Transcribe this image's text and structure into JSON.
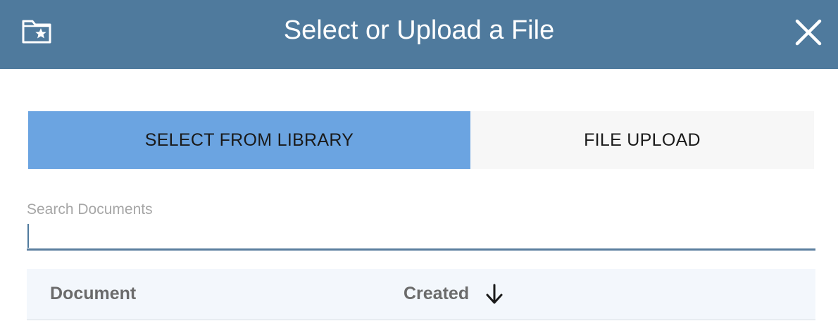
{
  "dialog": {
    "title": "Select or Upload a File",
    "header_icon": "folder-star-icon",
    "close_icon": "close-icon",
    "header_color": "#4f7a9d"
  },
  "tabs": [
    {
      "label": "SELECT FROM LIBRARY",
      "active": true,
      "color": "#6ba4e1"
    },
    {
      "label": "FILE UPLOAD",
      "active": false,
      "color": "#f7f7f7"
    }
  ],
  "search": {
    "label": "Search Documents",
    "value": "",
    "placeholder": ""
  },
  "table": {
    "columns": [
      {
        "label": "Document"
      },
      {
        "label": "Created",
        "sort": "descending",
        "sort_icon": "arrow-down-icon"
      }
    ]
  }
}
